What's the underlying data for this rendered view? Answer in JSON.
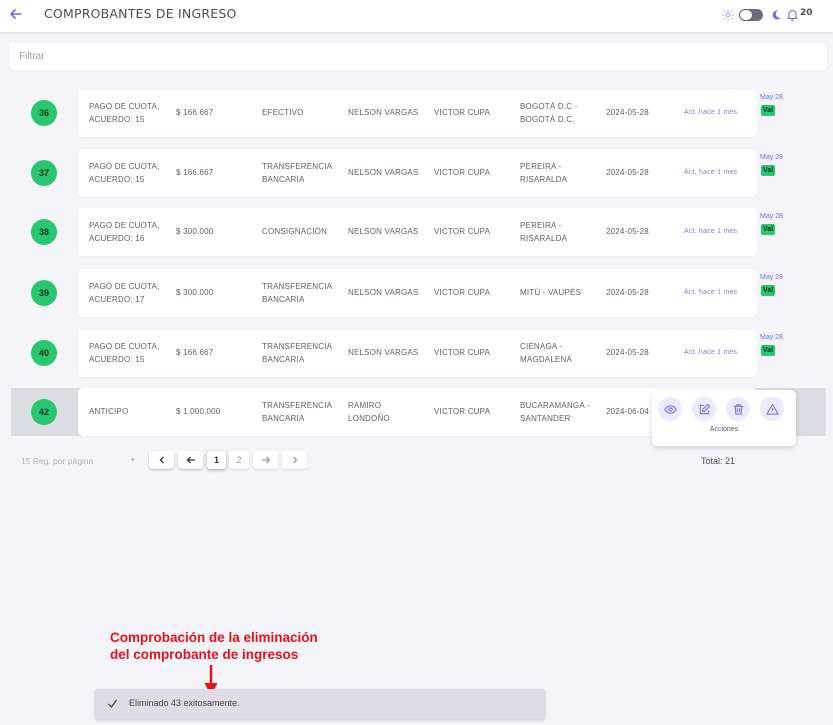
{
  "header": {
    "title": "COMPROBANTES DE INGRESO",
    "notification_count": "20"
  },
  "filter": {
    "placeholder": "Filtrar"
  },
  "rows": [
    {
      "id": "36",
      "concept": [
        "PAGO DE CUOTA,",
        "ACUERDO: 15"
      ],
      "amount": "$ 166.667",
      "method": [
        "EFECTIVO"
      ],
      "client": [
        "NELSON VARGAS"
      ],
      "agent": "VICTOR CUPA",
      "city": [
        "BOGOTÁ D.C -",
        "BOGOTÁ D.C."
      ],
      "date": "2024-05-28",
      "updated": "Act. hace 1 mes",
      "stamp": "May 28",
      "status": "Val"
    },
    {
      "id": "37",
      "concept": [
        "PAGO DE CUOTA,",
        "ACUERDO: 15"
      ],
      "amount": "$ 166.667",
      "method": [
        "TRANSFERENCIA",
        "BANCARIA"
      ],
      "client": [
        "NELSON VARGAS"
      ],
      "agent": "VICTOR CUPA",
      "city": [
        "PEREIRA -",
        "RISARALDA"
      ],
      "date": "2024-05-28",
      "updated": "Act. hace 1 mes",
      "stamp": "May 28",
      "status": "Val"
    },
    {
      "id": "38",
      "concept": [
        "PAGO DE CUOTA,",
        "ACUERDO: 16"
      ],
      "amount": "$ 300.000",
      "method": [
        "CONSIGNACIÓN"
      ],
      "client": [
        "NELSON VARGAS"
      ],
      "agent": "VICTOR CUPA",
      "city": [
        "PEREIRA -",
        "RISARALDA"
      ],
      "date": "2024-05-28",
      "updated": "Act. hace 1 mes",
      "stamp": "May 28",
      "status": "Val"
    },
    {
      "id": "39",
      "concept": [
        "PAGO DE CUOTA,",
        "ACUERDO: 17"
      ],
      "amount": "$ 300.000",
      "method": [
        "TRANSFERENCIA",
        "BANCARIA"
      ],
      "client": [
        "NELSON VARGAS"
      ],
      "agent": "VICTOR CUPA",
      "city": [
        "MITÚ - VAUPÉS"
      ],
      "date": "2024-05-28",
      "updated": "Act. hace 1 mes",
      "stamp": "May 28",
      "status": "Val"
    },
    {
      "id": "40",
      "concept": [
        "PAGO DE CUOTA,",
        "ACUERDO: 15"
      ],
      "amount": "$ 166.667",
      "method": [
        "TRANSFERENCIA",
        "BANCARIA"
      ],
      "client": [
        "NELSON VARGAS"
      ],
      "agent": "VICTOR CUPA",
      "city": [
        "CIÉNAGA -",
        "MAGDALENA"
      ],
      "date": "2024-05-28",
      "updated": "Act. hace 1 mes",
      "stamp": "May 28",
      "status": "Val"
    },
    {
      "id": "42",
      "concept": [
        "ANTICIPO"
      ],
      "amount": "$ 1.000.000",
      "method": [
        "TRANSFERENCIA",
        "BANCARIA"
      ],
      "client": [
        "RAMIRO",
        "LONDOÑO"
      ],
      "agent": "VICTOR CUPA",
      "city": [
        "BUCARAMANGA -",
        "SANTANDER"
      ],
      "date": "2024-06-04",
      "updated": "",
      "stamp": "",
      "status": ""
    }
  ],
  "actions": {
    "label": "Acciones"
  },
  "pagination": {
    "per_page_label": "15 Reg. por página",
    "pages": [
      "1",
      "2"
    ],
    "current_page": "1",
    "total_label": "Total: 21"
  },
  "annotation": {
    "line1": "Comprobación de la eliminación",
    "line2": "del comprobante de ingresos"
  },
  "toast": {
    "message": "Eliminado 43 exitosamente."
  },
  "colors": {
    "accent": "#7367f0",
    "badge_green": "#28c76f",
    "annotation_red": "#e8101a"
  }
}
